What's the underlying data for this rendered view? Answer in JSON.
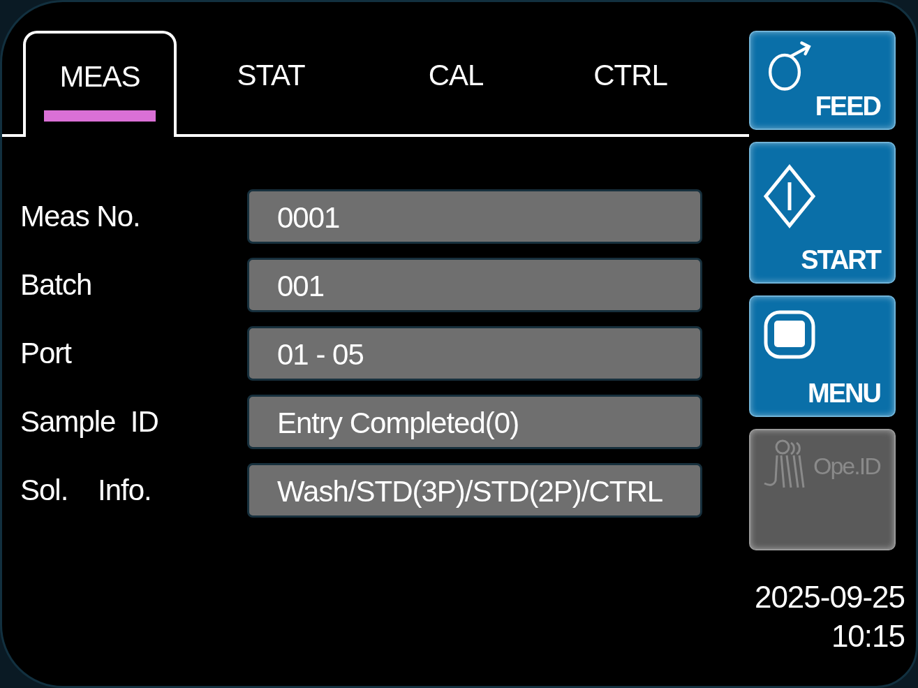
{
  "tabs": [
    {
      "label": "MEAS",
      "selected": true
    },
    {
      "label": "STAT",
      "selected": false
    },
    {
      "label": "CAL",
      "selected": false
    },
    {
      "label": "CTRL",
      "selected": false
    }
  ],
  "fields": [
    {
      "label": "Meas No.",
      "value": "0001"
    },
    {
      "label": "Batch",
      "value": "001"
    },
    {
      "label": "Port",
      "value": "01 - 05"
    },
    {
      "label": "Sample  ID",
      "value": "Entry Completed(0)"
    },
    {
      "label": "Sol.    Info.",
      "value": "Wash/STD(3P)/STD(2P)/CTRL"
    }
  ],
  "side_buttons": [
    {
      "kind": "feed",
      "label": "FEED",
      "disabled": false
    },
    {
      "kind": "start",
      "label": "START",
      "disabled": false
    },
    {
      "kind": "menu",
      "label": "MENU",
      "disabled": false
    },
    {
      "kind": "operator",
      "label": "Ope.ID",
      "disabled": true
    }
  ],
  "datetime": {
    "date": "2025-09-25",
    "time": "10:15"
  }
}
